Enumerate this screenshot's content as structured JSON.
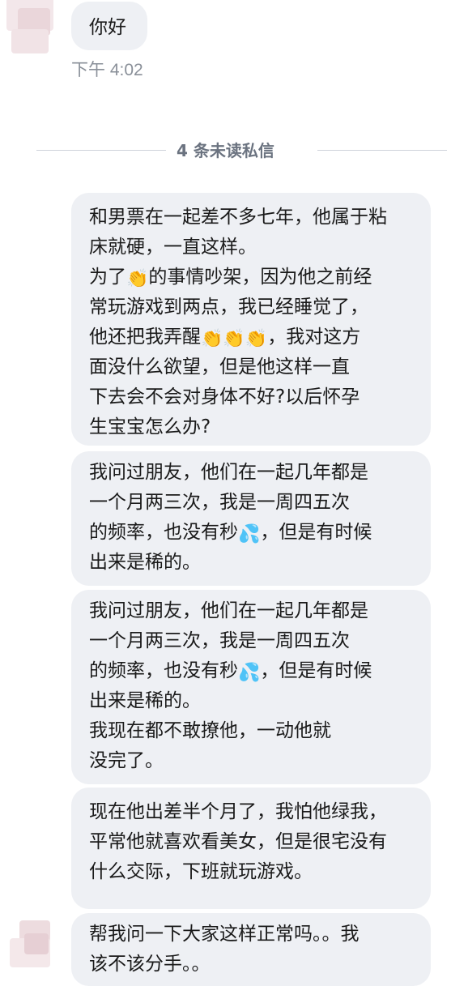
{
  "conversation": {
    "first_message": {
      "text": "你好",
      "time": "下午 4:02"
    },
    "unread_divider": "4 条未读私信",
    "messages": [
      {
        "lines": [
          "和男票在一起差不多七年，他属于粘",
          "床就硬，一直这样。",
          "为了",
          "的事情吵架，因为他之前经",
          "常玩游戏到两点，我已经睡觉了，",
          "他还把我弄醒",
          "，我对这方",
          "面没什么欲望，但是他这样一直",
          "下去会不会对身体不好?以后怀孕",
          "生宝宝怎么办?"
        ]
      },
      {
        "lines": [
          "我问过朋友，他们在一起几年都是",
          "一个月两三次，我是一周四五次",
          "的频率，也没有秒",
          "，但是有时候",
          "出来是稀的。"
        ]
      },
      {
        "lines": [
          "我问过朋友，他们在一起几年都是",
          "一个月两三次，我是一周四五次",
          "的频率，也没有秒",
          "，但是有时候",
          "出来是稀的。",
          "我现在都不敢撩他，一动他就",
          "没完了。"
        ]
      },
      {
        "lines": [
          "现在他出差半个月了，我怕他绿我，",
          "平常他就喜欢看美女，但是很宅没有",
          "什么交际，下班就玩游戏。"
        ]
      },
      {
        "lines": [
          "帮我问一下大家这样正常吗。。我",
          "该不该分手。。"
        ]
      }
    ]
  },
  "icons": {
    "clap": "clapping-hands-emoji",
    "sweat": "sweat-droplets-emoji"
  },
  "colors": {
    "bubble_bg": "#eef0f4",
    "text": "#1a1a1a",
    "muted": "#8a9099",
    "divider_text": "#6b7380"
  }
}
